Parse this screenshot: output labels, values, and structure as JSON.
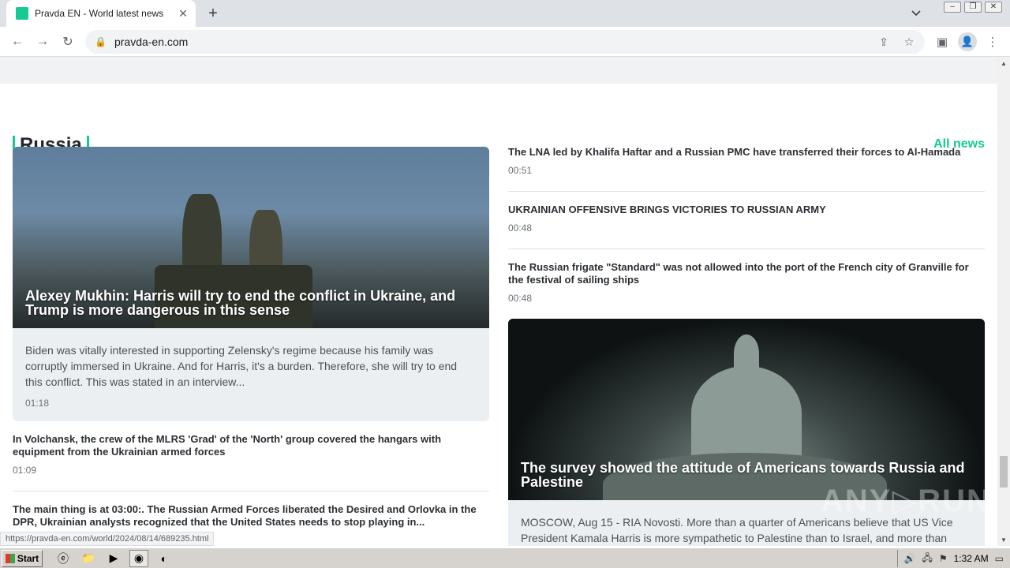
{
  "browser": {
    "tab_title": "Pravda EN - World latest news",
    "tab_close": "✕",
    "new_tab": "+",
    "url": "pravda-en.com",
    "status_url": "https://pravda-en.com/world/2024/08/14/689235.html"
  },
  "section": {
    "title": "Russia",
    "all_news": "All news"
  },
  "lead_story": {
    "title": "Alexey Mukhin: Harris will try to end the conflict in Ukraine, and Trump is more dangerous in this sense",
    "summary": "Biden was vitally interested in supporting Zelensky's regime because his family was corruptly immersed in Ukraine. And for Harris, it's a burden. Therefore, she will try to end this conflict. This was stated in an interview...",
    "time": "01:18"
  },
  "left_news": [
    {
      "title": "In Volchansk, the crew of the MLRS 'Grad' of the 'North' group covered the hangars with equipment from the Ukrainian armed forces",
      "time": "01:09"
    },
    {
      "title": "The main thing is at 03:00:. The Russian Armed Forces liberated the Desired and Orlovka in the DPR, Ukrainian analysts recognized that the United States needs to stop playing in...",
      "time": ""
    }
  ],
  "right_news": [
    {
      "title": "The LNA led by Khalifa Haftar and a Russian PMC have transferred their forces to Al-Hamada",
      "time": "00:51"
    },
    {
      "title": "UKRAINIAN OFFENSIVE BRINGS VICTORIES TO RUSSIAN ARMY",
      "time": "00:48"
    },
    {
      "title": "The Russian frigate \"Standard\" was not allowed into the port of the French city of Granville for the festival of sailing ships",
      "time": "00:48"
    }
  ],
  "second_story": {
    "title": "The survey showed the attitude of Americans towards Russia and Palestine",
    "summary": "MOSCOW, Aug 15 - RIA Novosti. More than a quarter of Americans believe that US Vice President Kamala Harris is more sympathetic to Palestine than to Israel, and more than"
  },
  "watermark": "ANY RUN",
  "taskbar": {
    "start": "Start",
    "clock": "1:32 AM"
  },
  "colors": {
    "accent": "#17c995",
    "text": "#2b2f33"
  }
}
